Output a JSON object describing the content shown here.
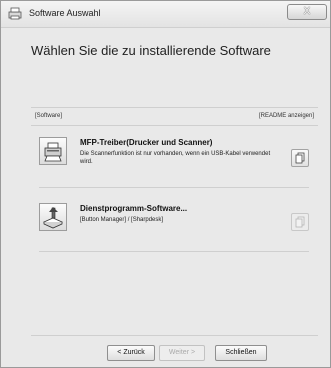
{
  "window": {
    "title": "Software Auswahl",
    "close_label": "X"
  },
  "main": {
    "heading": "Wählen Sie die zu installierende Software",
    "list_header": {
      "left": "[Software]",
      "right": "[README anzeigen]"
    },
    "items": [
      {
        "title": "MFP-Treiber(Drucker und Scanner)",
        "description": "Die Scannerfunktion ist nur vorhanden, wenn ein USB-Kabel verwendet wird.",
        "icon": "printer-scanner-icon",
        "readme_enabled": true
      },
      {
        "title": "Dienstprogramm-Software...",
        "description": "[Button Manager] / [Sharpdesk]",
        "icon": "utility-software-icon",
        "readme_enabled": false
      }
    ]
  },
  "footer": {
    "back_label": "< Zurück",
    "next_label": "Weiter >",
    "close_label": "Schließen"
  }
}
